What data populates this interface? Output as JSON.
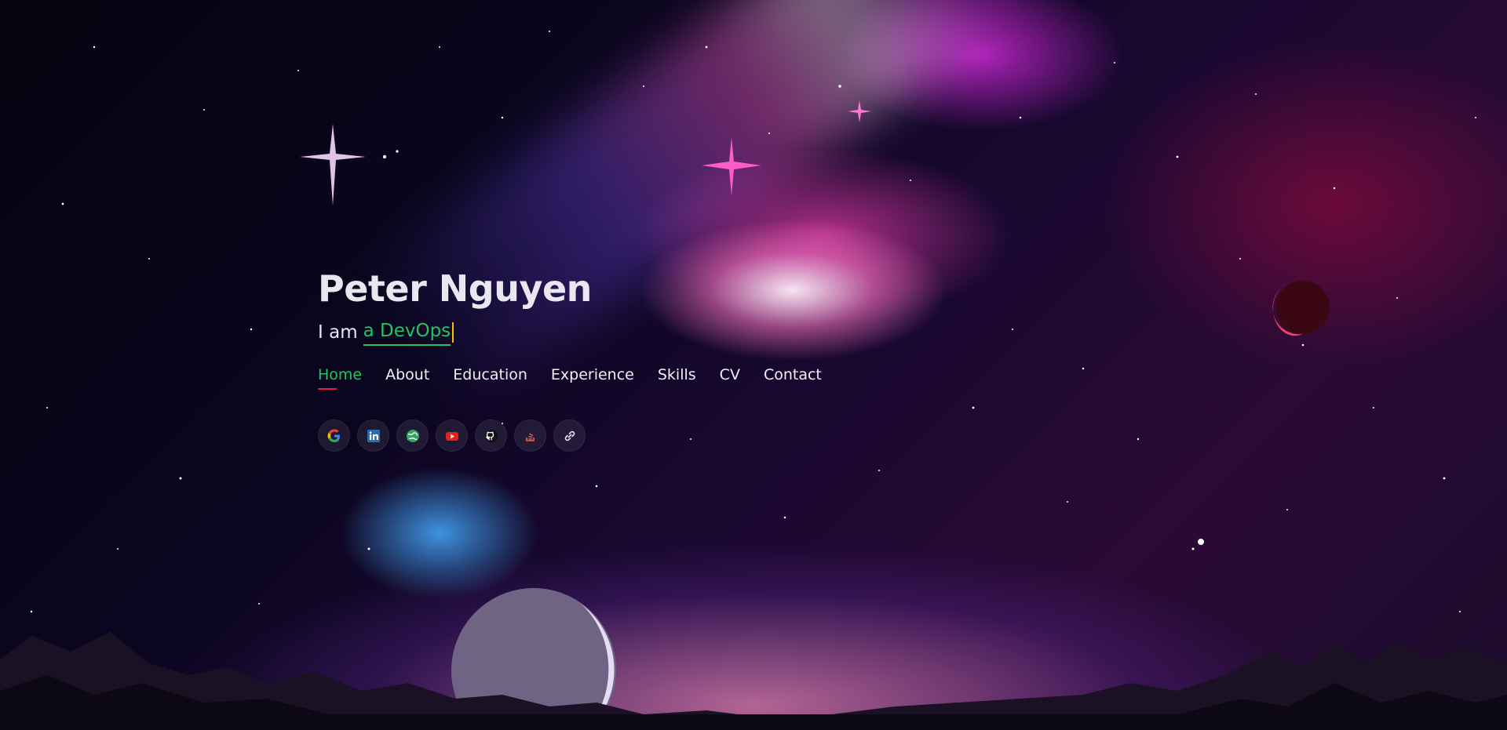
{
  "hero": {
    "name": "Peter Nguyen",
    "tagline_prefix": "I am",
    "tagline_role": "a DevOps"
  },
  "nav": {
    "items": [
      {
        "label": "Home",
        "active": true
      },
      {
        "label": "About"
      },
      {
        "label": "Education"
      },
      {
        "label": "Experience"
      },
      {
        "label": "Skills"
      },
      {
        "label": "CV"
      },
      {
        "label": "Contact"
      }
    ]
  },
  "socials": [
    {
      "icon": "google-icon"
    },
    {
      "icon": "linkedin-icon"
    },
    {
      "icon": "web-globe-icon"
    },
    {
      "icon": "youtube-icon"
    },
    {
      "icon": "github-icon"
    },
    {
      "icon": "stackoverflow-icon"
    },
    {
      "icon": "link-icon"
    }
  ],
  "colors": {
    "accent_green": "#22c55e",
    "nav_underline": "#e11d48",
    "caret": "#f6c200",
    "text": "#eae6f2"
  }
}
